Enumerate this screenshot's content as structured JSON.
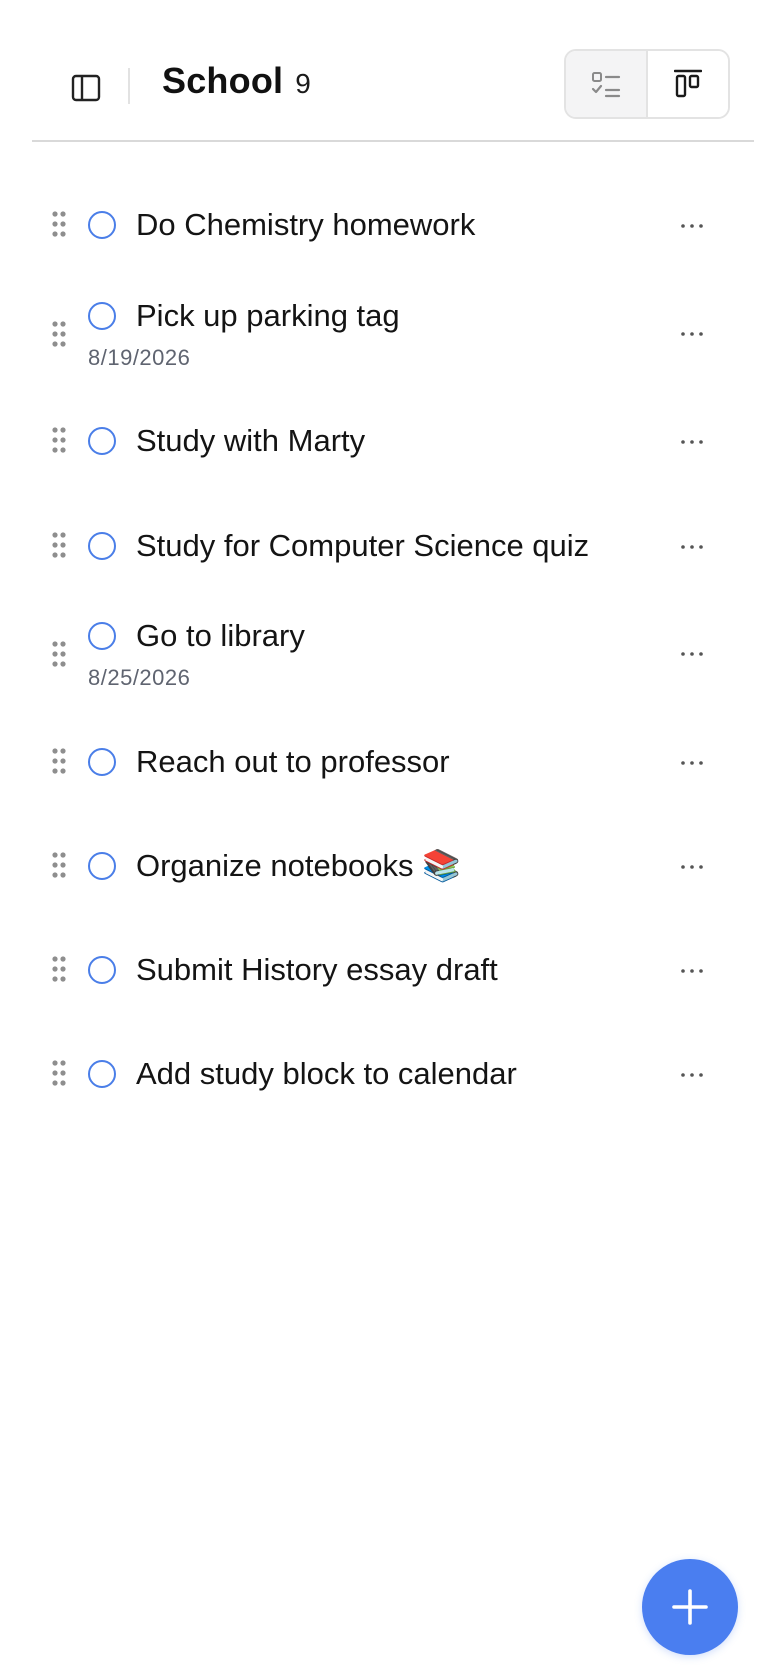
{
  "header": {
    "title": "School",
    "count": "9",
    "sidebar_toggle_icon": "sidebar-panel-icon",
    "view_list_icon": "checklist-view-icon",
    "view_board_icon": "board-view-icon"
  },
  "colors": {
    "accent": "#4a7ef0",
    "checkbox_border": "#4a7ee8",
    "date_text": "#5f6470",
    "divider": "#d9d9d9"
  },
  "tasks": [
    {
      "title": "Do Chemistry homework",
      "date": ""
    },
    {
      "title": "Pick up parking tag",
      "date": "8/19/2026"
    },
    {
      "title": "Study with Marty",
      "date": ""
    },
    {
      "title": "Study for Computer Science quiz",
      "date": ""
    },
    {
      "title": "Go to library",
      "date": "8/25/2026"
    },
    {
      "title": "Reach out to professor",
      "date": ""
    },
    {
      "title": "Organize notebooks 📚",
      "date": ""
    },
    {
      "title": "Submit History essay draft",
      "date": ""
    },
    {
      "title": "Add study block to calendar",
      "date": ""
    }
  ],
  "fab": {
    "icon": "plus-icon"
  }
}
